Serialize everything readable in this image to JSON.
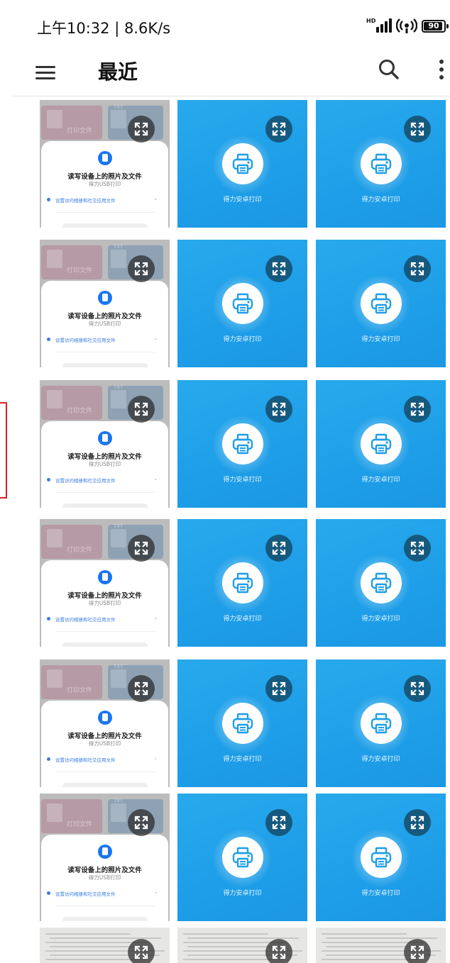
{
  "status_bar": {
    "time": "上午10:32 | 8.6K/s",
    "network_badge": "HD",
    "battery": "90",
    "icons": [
      "signal-icon",
      "hotspot-icon",
      "battery-icon"
    ]
  },
  "app_bar": {
    "title": "最近",
    "menu_icon": "menu-icon",
    "search_icon": "search-icon",
    "more_icon": "more-icon"
  },
  "colors": {
    "app_blue": "#1e9ee8",
    "expand_overlay_blue": "#16597f",
    "accent_blue": "#1976f0",
    "marker_red": "#e02020"
  },
  "screenshot_tile": {
    "card_left_label": "打印文件",
    "card_right_label": "TXT",
    "permission_title": "读写设备上的照片及文件",
    "permission_app": "得力USB打印",
    "option_label": "设置访问相册和社交应用文件"
  },
  "app_tile": {
    "name": "得力安卓打印"
  },
  "grid": {
    "row_types": [
      "shot-app-app",
      "shot-app-app",
      "shot-app-app",
      "shot-app-app",
      "shot-app-app",
      "shot-app-app",
      "doc-doc-doc"
    ],
    "expand_icon": "expand-icon"
  }
}
